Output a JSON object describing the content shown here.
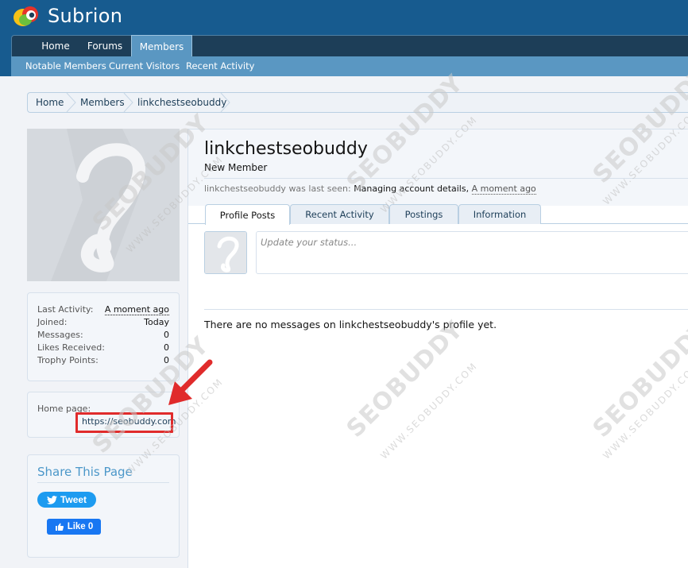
{
  "app": {
    "name": "Subrion"
  },
  "colors": {
    "header": "#175b8f",
    "nav": "#1d3e58",
    "subnav": "#5a97c2",
    "highlight": "#e02b2b",
    "twitter": "#1d9bf0",
    "facebook": "#1877f2"
  },
  "nav": {
    "tabs": [
      {
        "label": "Home"
      },
      {
        "label": "Forums"
      },
      {
        "label": "Members"
      }
    ],
    "active": "Members"
  },
  "subnav": {
    "items": [
      {
        "label": "Notable Members"
      },
      {
        "label": "Current Visitors"
      },
      {
        "label": "Recent Activity"
      }
    ]
  },
  "breadcrumb": {
    "items": [
      {
        "label": "Home"
      },
      {
        "label": "Members"
      },
      {
        "label": "linkchestseobuddy"
      }
    ]
  },
  "sidebar": {
    "stats": [
      {
        "label": "Last Activity:",
        "value": "A moment ago"
      },
      {
        "label": "Joined:",
        "value": "Today"
      },
      {
        "label": "Messages:",
        "value": "0"
      },
      {
        "label": "Likes Received:",
        "value": "0"
      },
      {
        "label": "Trophy Points:",
        "value": "0"
      }
    ],
    "homepage": {
      "label": "Home page:",
      "url": "https://seobuddy.com"
    },
    "share": {
      "title": "Share This Page",
      "tweet_label": "Tweet",
      "like_label": "Like 0"
    }
  },
  "profile": {
    "username": "linkchestseobuddy",
    "user_title": "New Member",
    "last_seen": {
      "prefix": "linkchestseobuddy was last seen:",
      "activity": "Managing account details,",
      "time": "A moment ago"
    },
    "tabs": [
      {
        "label": "Profile Posts"
      },
      {
        "label": "Recent Activity"
      },
      {
        "label": "Postings"
      },
      {
        "label": "Information"
      }
    ],
    "active_tab": "Profile Posts",
    "status_placeholder": "Update your status...",
    "empty_message": "There are no messages on linkchestseobuddy's profile yet."
  },
  "icons": {
    "logo": "subrion-logo-icon",
    "avatar": "default-avatar-icon",
    "tweet": "twitter-bird-icon",
    "like": "facebook-thumb-icon",
    "annotation": "red-arrow-icon"
  },
  "watermark": {
    "big": "SEOBUDDY",
    "small": "WWW.SEOBUDDY.COM"
  }
}
